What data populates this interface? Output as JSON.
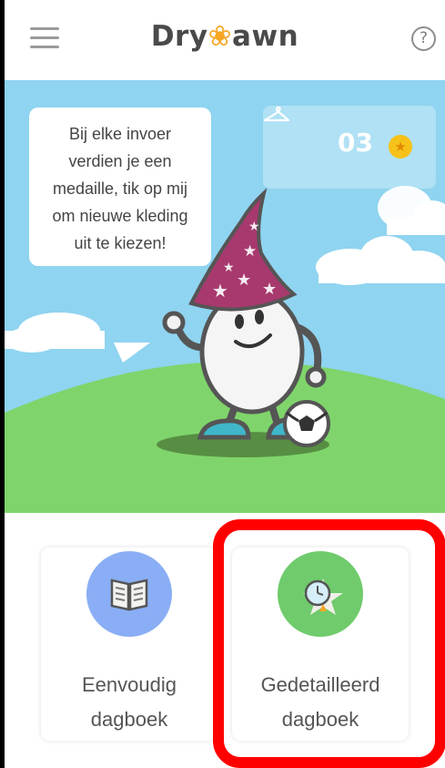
{
  "header": {
    "logo_part1": "Dry",
    "logo_part2": "awn",
    "help_label": "?"
  },
  "speech_bubble": {
    "lines": [
      "Bij elke invoer",
      "verdien je een",
      "medaille, tik op mij",
      "om nieuwe kleding",
      "uit te kiezen!"
    ]
  },
  "medal_counter": {
    "count": "03",
    "hanger_icon": "hanger-icon",
    "coin_icon": "star-coin-icon"
  },
  "cards": [
    {
      "line1": "Eenvoudig",
      "line2": "dagboek",
      "icon": "book-icon",
      "color": "#8aaef5"
    },
    {
      "line1": "Gedetailleerd",
      "line2": "dagboek",
      "icon": "clock-star-icon",
      "color": "#6fcb6b"
    }
  ],
  "colors": {
    "sky": "#8fd4f0",
    "grass": "#7fd56b",
    "hat": "#a8396e",
    "logo_drop": "#f5a623",
    "highlight": "#ff0000"
  }
}
